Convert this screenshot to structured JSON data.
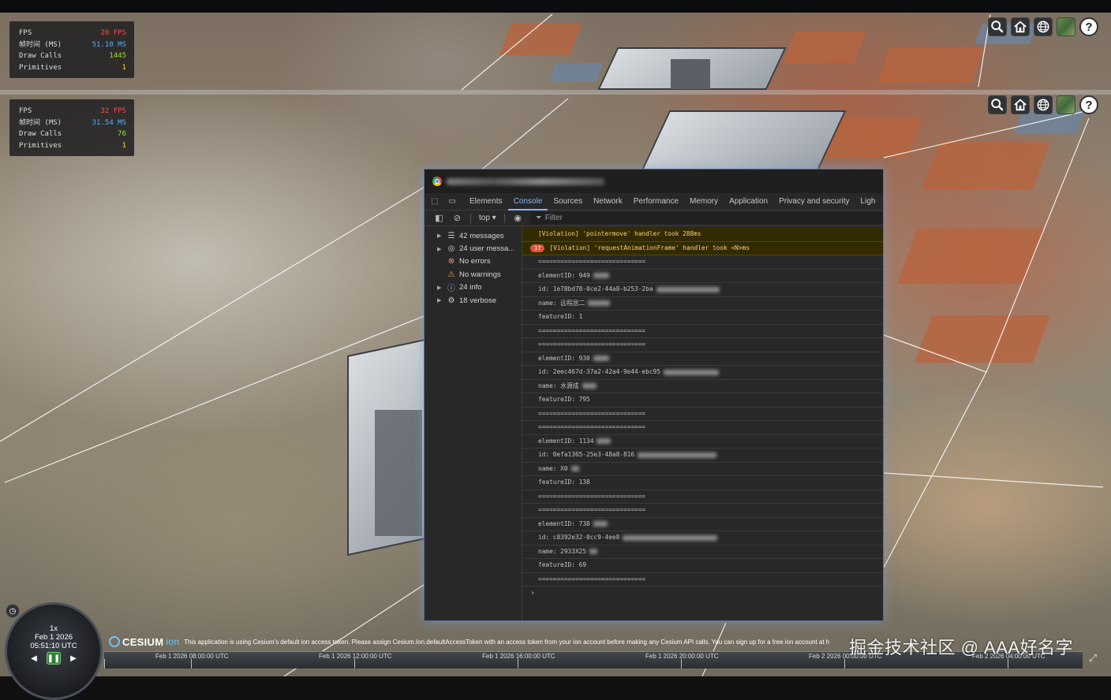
{
  "fps_panels": [
    {
      "fps_label": "FPS",
      "fps_value": "20 FPS",
      "frame_label": "帧时间 (MS)",
      "frame_value": "51.10 MS",
      "draw_label": "Draw Calls",
      "draw_value": "1445",
      "prim_label": "Primitives",
      "prim_value": "1"
    },
    {
      "fps_label": "FPS",
      "fps_value": "32 FPS",
      "frame_label": "帧时间 (MS)",
      "frame_value": "31.54 MS",
      "draw_label": "Draw Calls",
      "draw_value": "76",
      "prim_label": "Primitives",
      "prim_value": "1"
    }
  ],
  "toolbar": {
    "help_label": "?"
  },
  "devtools": {
    "tabs": [
      "Elements",
      "Console",
      "Sources",
      "Network",
      "Performance",
      "Memory",
      "Application",
      "Privacy and security",
      "Ligh"
    ],
    "active_tab": "Console",
    "context": "top ▾",
    "filter_placeholder": "Filter",
    "sidebar": [
      {
        "label": "42 messages",
        "icon": "list-icon"
      },
      {
        "label": "24 user messa...",
        "icon": "user-icon"
      },
      {
        "label": "No errors",
        "icon": "error-icon"
      },
      {
        "label": "No warnings",
        "icon": "warning-icon"
      },
      {
        "label": "24 info",
        "icon": "info-icon"
      },
      {
        "label": "18 verbose",
        "icon": "verbose-icon"
      }
    ],
    "violation1": "[Violation] 'pointermove' handler took 288ms",
    "violation2_count": "17",
    "violation2": "[Violation] 'requestAnimationFrame' handler took <N>ms",
    "logs": [
      "=============================",
      "elementID: 949",
      "id: 1e78bd78-0ce2-44a8-b253-2ba",
      "name: 远程居二",
      "featureID: 1",
      "=============================",
      "=============================",
      "elementID: 930",
      "id: 2eec467d-37a2-42a4-9e44-ebc95",
      "name: 水源成",
      "featureID: 795",
      "=============================",
      "=============================",
      "elementID: 1134",
      "id: 0efa1365-25e3-48a8-816",
      "name: X0",
      "featureID: 138",
      "=============================",
      "=============================",
      "elementID: 738",
      "id: c8392e32-0cc9-4ee8",
      "name: 2933X25",
      "featureID: 69",
      "============================="
    ],
    "prompt": "›"
  },
  "animation": {
    "speed": "1x",
    "date": "Feb 1 2026",
    "time": "05:51:10 UTC"
  },
  "credit": {
    "logo": "CESIUM",
    "ion": "ion",
    "text": "This application is using Cesium's default ion access token. Please assign Cesium.Ion.defaultAccessToken with an access token from your ion account before making any Cesium API calls. You can sign up for a free ion account at h"
  },
  "timeline": {
    "labels": [
      "Feb 1 2026 08:00:00 UTC",
      "Feb 1 2026 12:00:00 UTC",
      "Feb 1 2026 16:00:00 UTC",
      "Feb 1 2026 20:00:00 UTC",
      "Feb 2 2026 00:00:00 UTC",
      "Feb 2 2026 04:00:00 UTC"
    ]
  },
  "watermark": "掘金技术社区 @ AAA好名字"
}
